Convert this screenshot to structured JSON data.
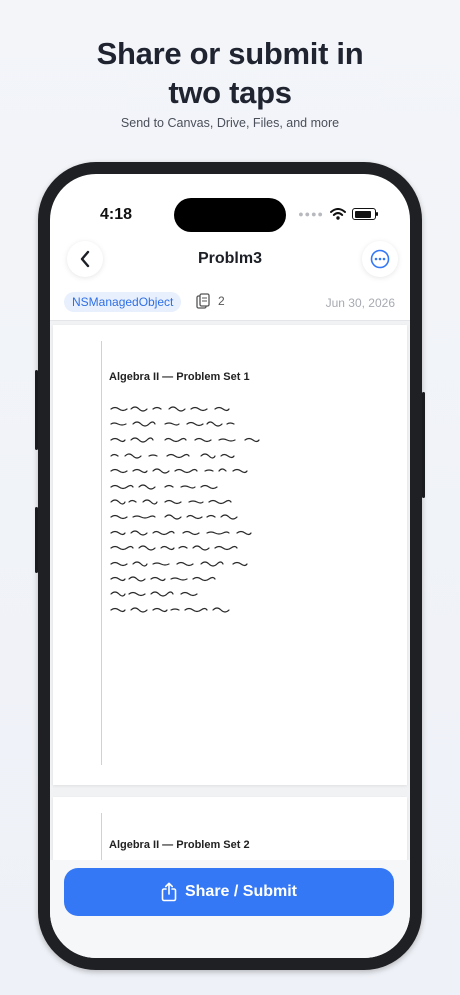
{
  "promo": {
    "headline_line1": "Share or submit in",
    "headline_line2": "two taps",
    "subline": "Send to Canvas, Drive, Files, and more"
  },
  "status_bar": {
    "time": "4:18"
  },
  "nav": {
    "title": "Problm3",
    "back_icon": "chevron-left-icon",
    "more_icon": "ellipsis-circle-icon"
  },
  "meta": {
    "tag": "NSManagedObject",
    "page_count": "2",
    "date": "Jun 30, 2026"
  },
  "pages": [
    {
      "title": "Algebra II — Problem Set 1"
    },
    {
      "title": "Algebra II — Problem Set 2"
    }
  ],
  "actions": {
    "share_label": "Share / Submit",
    "share_icon": "share-icon"
  },
  "colors": {
    "accent": "#3478f6",
    "tag_bg": "#e8f0fd",
    "tag_text": "#2f6fe4"
  }
}
